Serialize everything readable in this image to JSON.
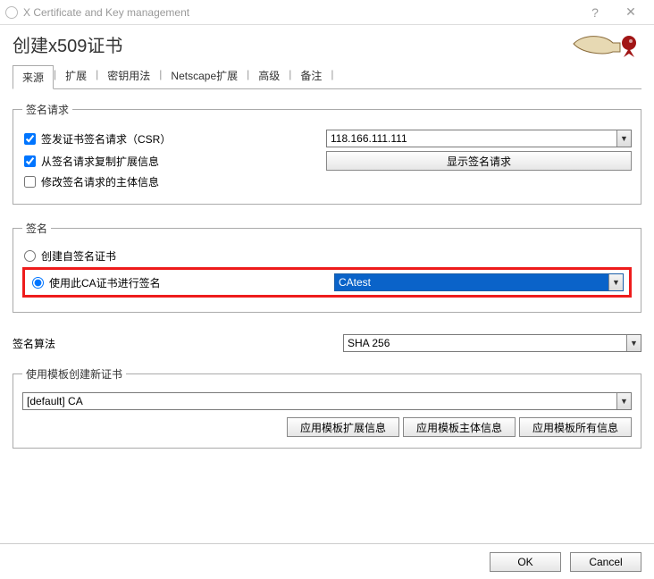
{
  "window": {
    "title": "X Certificate and Key management"
  },
  "page": {
    "heading": "创建x509证书"
  },
  "tabs": {
    "items": [
      {
        "label": "来源",
        "active": true
      },
      {
        "label": "扩展"
      },
      {
        "label": "密钥用法"
      },
      {
        "label": "Netscape扩展"
      },
      {
        "label": "高级"
      },
      {
        "label": "备注"
      }
    ]
  },
  "sign_request": {
    "legend": "签名请求",
    "csr_label": "签发证书签名请求（CSR）",
    "csr_checked": true,
    "copy_ext_label": "从签名请求复制扩展信息",
    "copy_ext_checked": true,
    "modify_subject_label": "修改签名请求的主体信息",
    "modify_subject_checked": false,
    "csr_value": "118.166.111.111",
    "show_request_btn": "显示签名请求"
  },
  "sign": {
    "legend": "签名",
    "self_sign_label": "创建自签名证书",
    "self_sign_selected": false,
    "use_ca_label": "使用此CA证书进行签名",
    "use_ca_selected": true,
    "ca_value": "CAtest"
  },
  "algo": {
    "label": "签名算法",
    "value": "SHA 256"
  },
  "template": {
    "legend": "使用模板创建新证书",
    "value": "[default] CA",
    "btn_ext": "应用模板扩展信息",
    "btn_subject": "应用模板主体信息",
    "btn_all": "应用模板所有信息"
  },
  "footer": {
    "ok": "OK",
    "cancel": "Cancel"
  }
}
